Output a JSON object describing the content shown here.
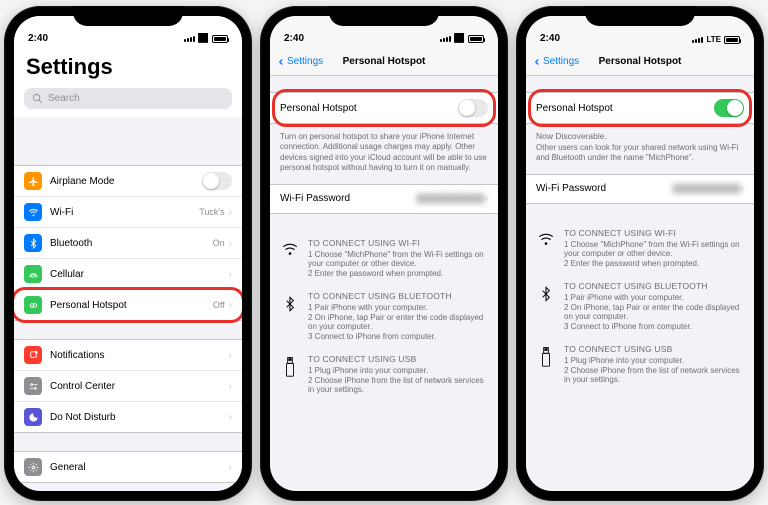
{
  "statusbar": {
    "time": "2:40",
    "ampm": "⁷",
    "carrier_lte": "LTE"
  },
  "phone1": {
    "title": "Settings",
    "search_placeholder": "Search",
    "rows": {
      "airplane": "Airplane Mode",
      "wifi": "Wi-Fi",
      "wifi_val": "Tuck's",
      "bluetooth": "Bluetooth",
      "bluetooth_val": "On",
      "cellular": "Cellular",
      "hotspot": "Personal Hotspot",
      "hotspot_val": "Off",
      "notifications": "Notifications",
      "controlcenter": "Control Center",
      "dnd": "Do Not Disturb",
      "general": "General"
    }
  },
  "phone2": {
    "back": "Settings",
    "title": "Personal Hotspot",
    "toggle_label": "Personal Hotspot",
    "description": "Turn on personal hotspot to share your iPhone Internet connection. Additional usage charges may apply. Other devices signed into your iCloud account will be able to use personal hotspot without having to turn it on manually.",
    "wifipw_label": "Wi-Fi Password"
  },
  "phone3": {
    "back": "Settings",
    "title": "Personal Hotspot",
    "toggle_label": "Personal Hotspot",
    "now_discoverable": "Now Discoverable.",
    "description": "Other users can look for your shared network using Wi-Fi and Bluetooth under the name \"MichPhone\".",
    "wifipw_label": "Wi-Fi Password"
  },
  "connect": {
    "wifi_title": "TO CONNECT USING WI-FI",
    "wifi_step1": "1 Choose \"MichPhone\" from the Wi-Fi settings on your computer or other device.",
    "wifi_step2": "2 Enter the password when prompted.",
    "bt_title": "TO CONNECT USING BLUETOOTH",
    "bt_step1": "1 Pair iPhone with your computer.",
    "bt_step2": "2 On iPhone, tap Pair or enter the code displayed on your computer.",
    "bt_step3": "3 Connect to iPhone from computer.",
    "usb_title": "TO CONNECT USING USB",
    "usb_step1": "1 Plug iPhone into your computer.",
    "usb_step2": "2 Choose iPhone from the list of network services in your settings."
  },
  "colors": {
    "orange": "#ff9500",
    "blue": "#007aff",
    "green": "#34c759",
    "red": "#ff3b30",
    "gray": "#8e8e93",
    "purple": "#5856d6"
  }
}
